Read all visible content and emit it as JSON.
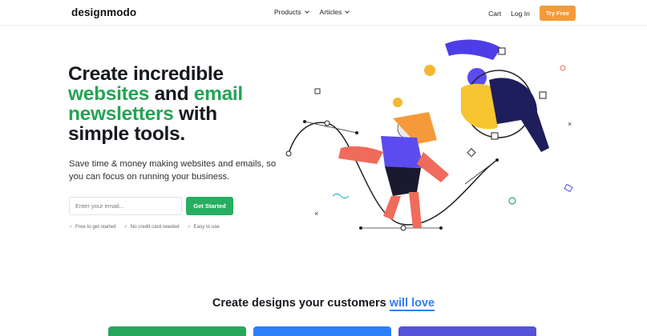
{
  "header": {
    "logo": "designmodo",
    "nav": [
      {
        "label": "Products"
      },
      {
        "label": "Articles"
      }
    ],
    "cart": "Cart",
    "login": "Log In",
    "try_free": "Try Free"
  },
  "hero": {
    "line1": "Create incredible",
    "line2_green_a": "websites",
    "line2_mid": " and ",
    "line2_green_b": "email",
    "line3_green": "newsletters",
    "line3_rest": " with",
    "line4": "simple tools.",
    "subtitle": "Save time & money making websites and emails, so you can focus on running your business.",
    "email_placeholder": "Enter your email...",
    "cta": "Get Started",
    "features": [
      "Free to get started",
      "No credit card needed",
      "Easy to use"
    ]
  },
  "section": {
    "title_prefix": "Create designs your customers ",
    "title_highlight": "will love"
  },
  "colors": {
    "brand_green": "#23a455",
    "accent_orange": "#f49a3a",
    "accent_blue": "#2d7ff9",
    "accent_purple": "#5553d8"
  }
}
